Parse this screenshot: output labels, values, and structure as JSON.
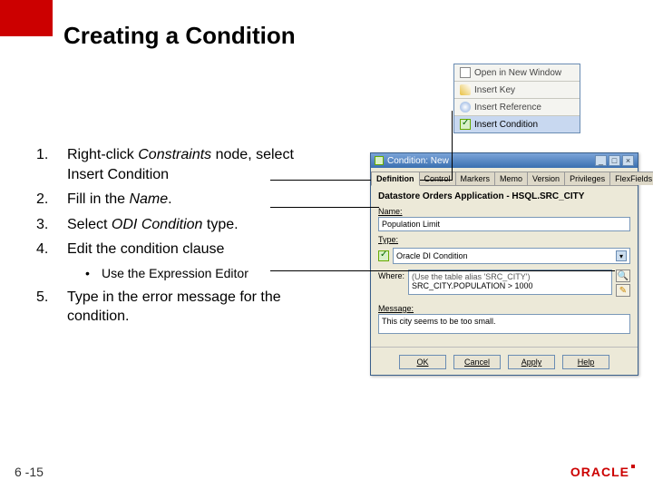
{
  "title": "Creating a Condition",
  "page_number": "6 -15",
  "logo": "ORACLE",
  "steps": [
    {
      "num": "1.",
      "text_a": "Right-click ",
      "text_i1": "Constraints",
      "text_b": " node, select",
      "text_c": "Insert Condition"
    },
    {
      "num": "2.",
      "text_a": "Fill in the ",
      "text_i1": "Name",
      "text_b": "."
    },
    {
      "num": "3.",
      "text_a": "Select ",
      "text_i1": "ODI Condition",
      "text_b": " type."
    },
    {
      "num": "4.",
      "text_a": "Edit the condition clause"
    },
    {
      "sub": true,
      "bullet": "•",
      "text": "Use the Expression Editor"
    },
    {
      "num": "5.",
      "text_a": "Type in the error message for the condition."
    }
  ],
  "context_menu": {
    "items": [
      {
        "label": "Open in New Window",
        "icon": "window-icon"
      },
      {
        "label": "Insert Key",
        "icon": "key-icon"
      },
      {
        "label": "Insert Reference",
        "icon": "reference-icon"
      },
      {
        "label": "Insert Condition",
        "icon": "condition-icon",
        "selected": true
      }
    ]
  },
  "dialog": {
    "title": "Condition: New",
    "win_buttons": {
      "min": "_",
      "max": "□",
      "close": "×"
    },
    "tabs": [
      "Definition",
      "Control",
      "Markers",
      "Memo",
      "Version",
      "Privileges",
      "FlexFields"
    ],
    "active_tab": 0,
    "heading": "Datastore Orders Application - HSQL.SRC_CITY",
    "name_label": "Name:",
    "name_value": "Population Limit",
    "type_label": "Type:",
    "type_icon_label": "condition-type-icon",
    "type_value": "Oracle DI Condition",
    "where_label": "Where:",
    "where_line1": "(Use the table alias 'SRC_CITY')",
    "where_line2": "SRC_CITY.POPULATION > 1000",
    "message_label": "Message:",
    "message_value": "This city seems to be too small.",
    "buttons": [
      "OK",
      "Cancel",
      "Apply",
      "Help"
    ]
  }
}
